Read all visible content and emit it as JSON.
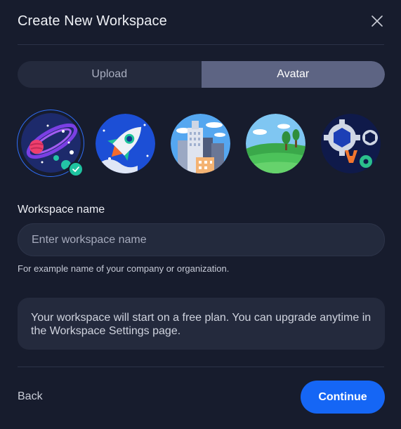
{
  "dialog": {
    "title": "Create New Workspace",
    "close_icon": "close-icon"
  },
  "tabs": [
    {
      "label": "Upload",
      "active": false
    },
    {
      "label": "Avatar",
      "active": true
    }
  ],
  "avatars": [
    {
      "icon": "galaxy-avatar-icon",
      "selected": true
    },
    {
      "icon": "rocket-avatar-icon",
      "selected": false
    },
    {
      "icon": "city-avatar-icon",
      "selected": false
    },
    {
      "icon": "landscape-avatar-icon",
      "selected": false
    },
    {
      "icon": "gears-avatar-icon",
      "selected": false
    }
  ],
  "workspace_name": {
    "label": "Workspace name",
    "placeholder": "Enter workspace name",
    "value": "",
    "hint": "For example name of your company or organization."
  },
  "info": {
    "text": "Your workspace will start on a free plan. You can upgrade anytime in the Workspace Settings page."
  },
  "footer": {
    "back_label": "Back",
    "continue_label": "Continue"
  },
  "colors": {
    "background": "#171c2d",
    "accent": "#1566f5",
    "selected_ring": "#2f6df6",
    "check_badge": "#1fc3a0"
  }
}
